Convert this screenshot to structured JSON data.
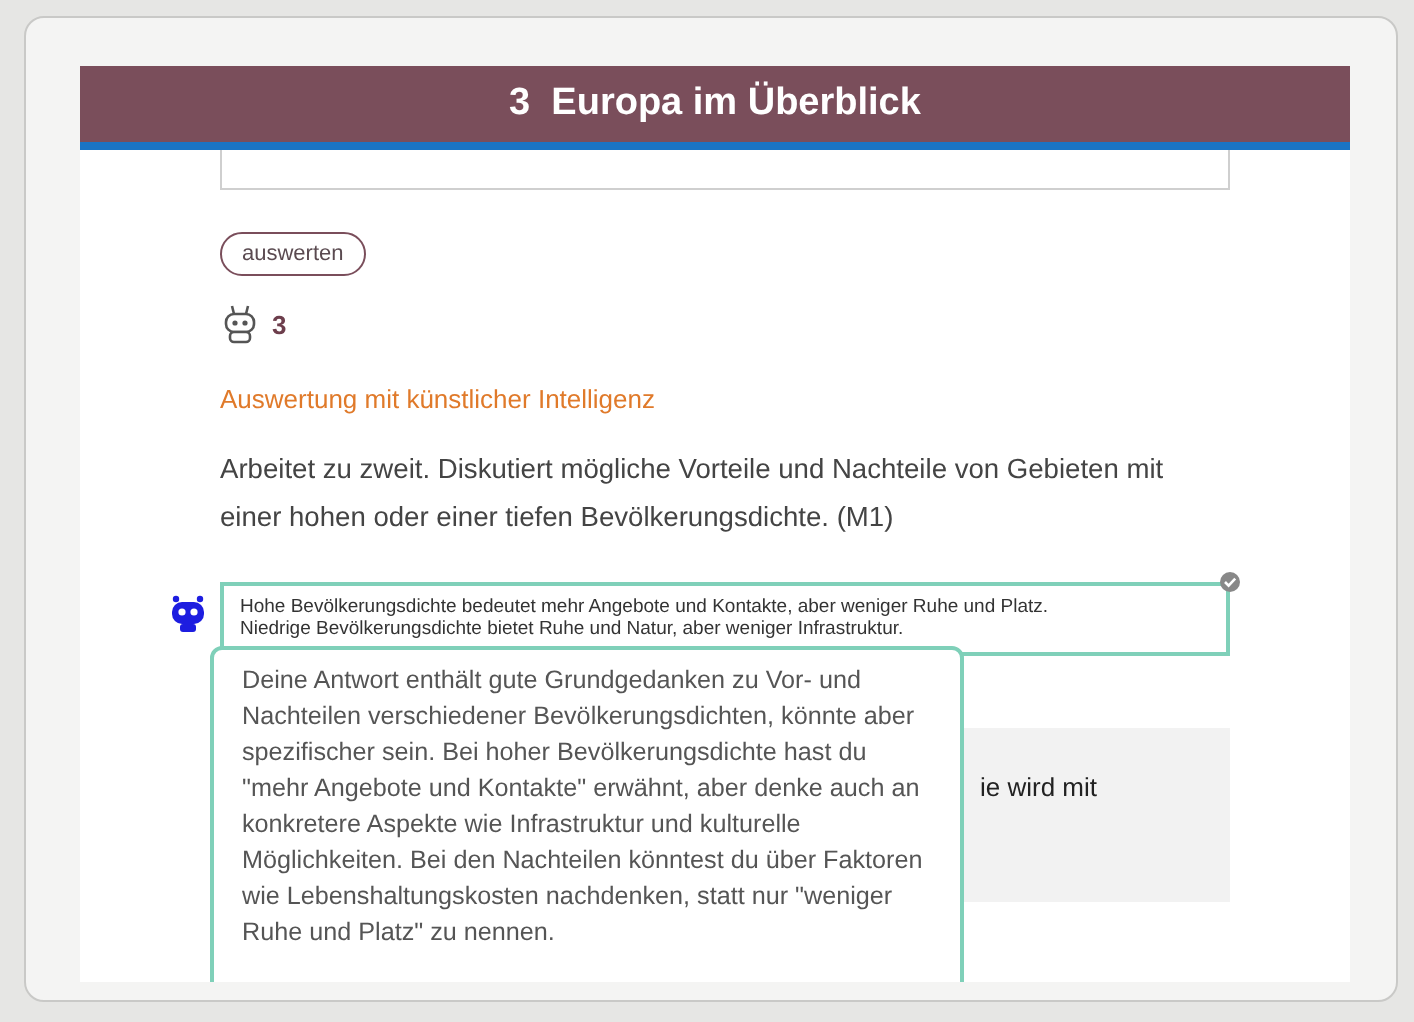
{
  "header": {
    "title": "3  Europa im Überblick"
  },
  "evaluate_button": {
    "label": "auswerten"
  },
  "ai_counter": {
    "count": "3"
  },
  "ai_heading": "Auswertung mit künstlicher Intelligenz",
  "task": "Arbeitet zu zweit. Diskutiert mögliche Vorteile und Nachteile von Gebieten mit einer hohen oder einer tiefen Bevölkerungsdichte. (M1)",
  "answer": {
    "value": "Hohe Bevölkerungsdichte bedeutet mehr Angebote und Kontakte, aber weniger Ruhe und Platz.\nNiedrige Bevölkerungsdichte bietet Ruhe und Natur, aber weniger Infrastruktur.",
    "checked": true
  },
  "hidden_note": "ie wird mit",
  "feedback": "Deine Antwort enthält gute Grundgedanken zu Vor- und Nachteilen verschiedener Bevölkerungsdichten, könnte aber spezifischer sein. Bei hoher Bevölkerungsdichte hast du \"mehr Angebote und Kontakte\" erwähnt, aber denke auch an konkretere Aspekte wie Infrastruktur und kulturelle Möglichkeiten. Bei den Nachteilen könntest du über Faktoren wie Lebenshaltungskosten nachdenken, statt nur \"weniger Ruhe und Platz\" zu nennen."
}
